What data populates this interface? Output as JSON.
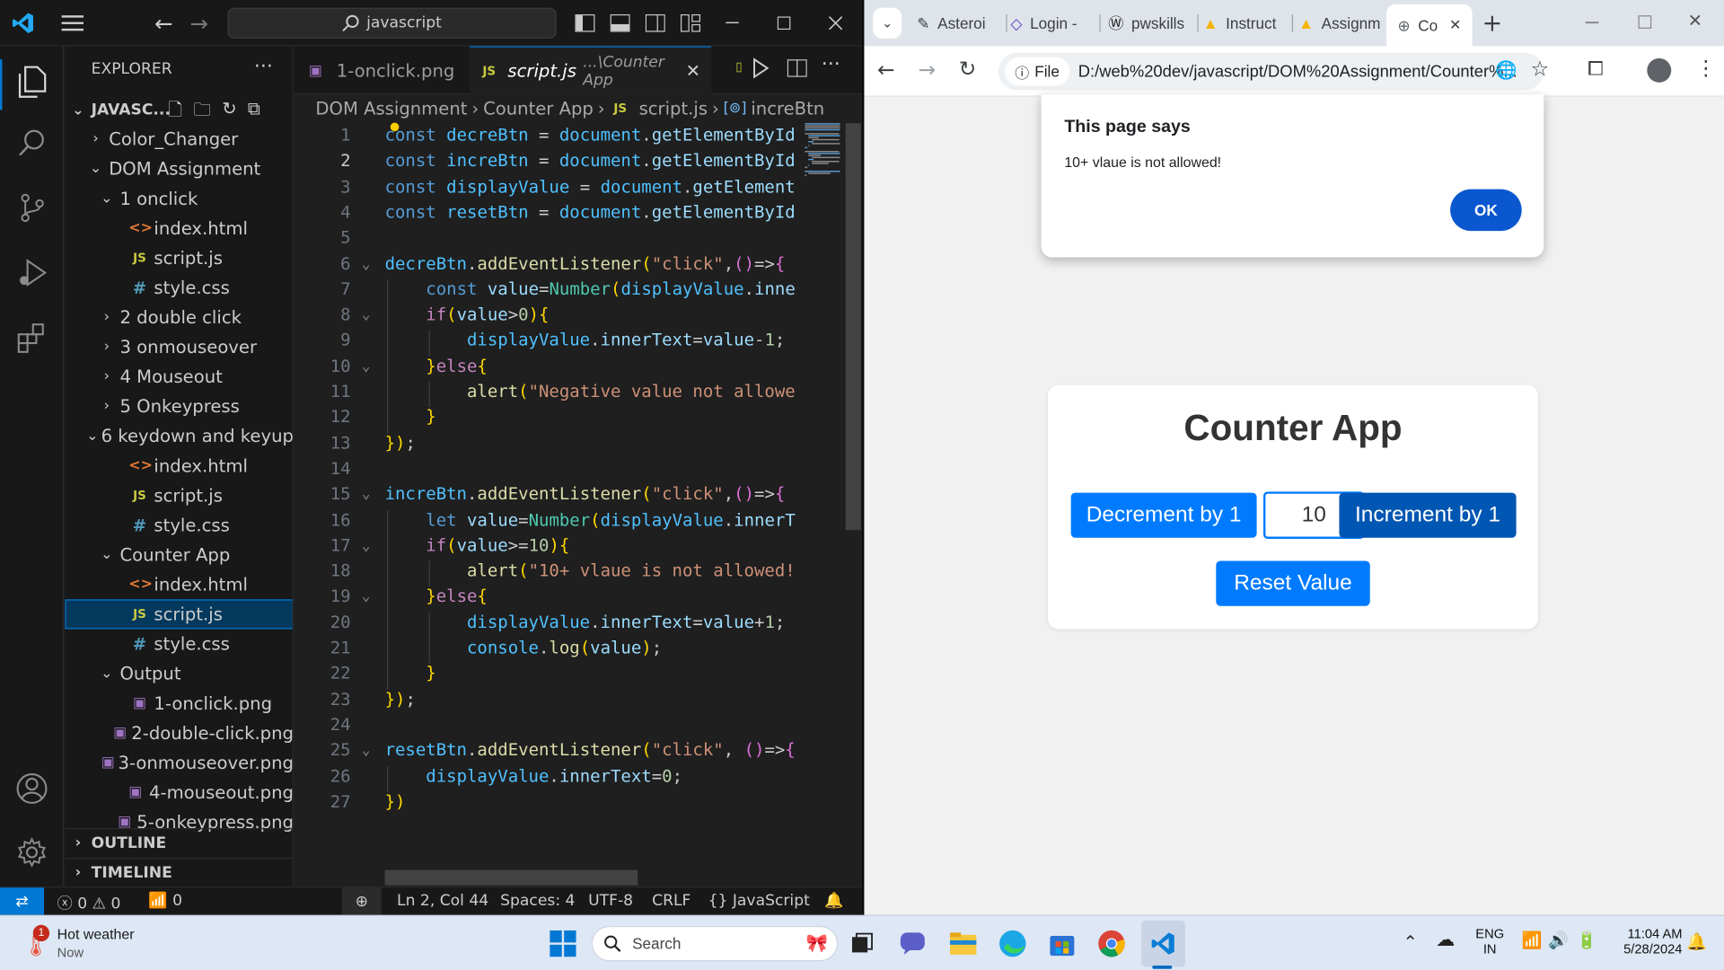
{
  "colors": {
    "vscode_bg": "#1f1f1f",
    "vscode_accent": "#0078d4",
    "chrome_primary_button": "#007bff",
    "dialog_ok": "#0b57d0"
  },
  "vscode": {
    "command_center": "javascript",
    "explorer": {
      "title": "EXPLORER",
      "root": "JAVASC...",
      "items": [
        {
          "label": "Color_Changer",
          "type": "folder",
          "open": false,
          "depth": 0
        },
        {
          "label": "DOM Assignment",
          "type": "folder",
          "open": true,
          "depth": 0
        },
        {
          "label": "1 onclick",
          "type": "folder",
          "open": true,
          "depth": 1
        },
        {
          "label": "index.html",
          "type": "html",
          "depth": 2
        },
        {
          "label": "script.js",
          "type": "js",
          "depth": 2
        },
        {
          "label": "style.css",
          "type": "css",
          "depth": 2
        },
        {
          "label": "2 double click",
          "type": "folder",
          "open": false,
          "depth": 1
        },
        {
          "label": "3 onmouseover",
          "type": "folder",
          "open": false,
          "depth": 1
        },
        {
          "label": "4 Mouseout",
          "type": "folder",
          "open": false,
          "depth": 1
        },
        {
          "label": "5 Onkeypress",
          "type": "folder",
          "open": false,
          "depth": 1
        },
        {
          "label": "6 keydown and keyup",
          "type": "folder",
          "open": true,
          "depth": 1
        },
        {
          "label": "index.html",
          "type": "html",
          "depth": 2
        },
        {
          "label": "script.js",
          "type": "js",
          "depth": 2
        },
        {
          "label": "style.css",
          "type": "css",
          "depth": 2
        },
        {
          "label": "Counter App",
          "type": "folder",
          "open": true,
          "depth": 1
        },
        {
          "label": "index.html",
          "type": "html",
          "depth": 2
        },
        {
          "label": "script.js",
          "type": "js",
          "depth": 2,
          "selected": true
        },
        {
          "label": "style.css",
          "type": "css",
          "depth": 2
        },
        {
          "label": "Output",
          "type": "folder",
          "open": true,
          "depth": 1
        },
        {
          "label": "1-onclick.png",
          "type": "png",
          "depth": 2
        },
        {
          "label": "2-double-click.png",
          "type": "png",
          "depth": 2
        },
        {
          "label": "3-onmouseover.png",
          "type": "png",
          "depth": 2
        },
        {
          "label": "4-mouseout.png",
          "type": "png",
          "depth": 2
        },
        {
          "label": "5-onkeypress.png",
          "type": "png",
          "depth": 2
        }
      ],
      "outline": "OUTLINE",
      "timeline": "TIMELINE"
    },
    "tabs": [
      {
        "label": "1-onclick.png",
        "active": false
      },
      {
        "label": "script.js",
        "path": "...\\Counter App",
        "active": true
      }
    ],
    "breadcrumbs": [
      "DOM Assignment",
      "Counter App",
      "script.js",
      "increBtn"
    ],
    "code": {
      "current_line": 2,
      "fold_lines": [
        6,
        8,
        10,
        15,
        17,
        19,
        25
      ],
      "lines": [
        "const decreBtn = document.getElementById",
        "const increBtn = document.getElementById",
        "const displayValue = document.getElement",
        "const resetBtn = document.getElementById",
        "",
        "decreBtn.addEventListener(\"click\",()=>{",
        "    const value=Number(displayValue.inne",
        "    if(value>0){",
        "        displayValue.innerText=value-1;",
        "    }else{",
        "        alert(\"Negative value not allowe",
        "    }",
        "});",
        "",
        "increBtn.addEventListener(\"click\",()=>{",
        "    let value=Number(displayValue.innerT",
        "    if(value>=10){",
        "        alert(\"10+ vlaue is not allowed!",
        "    }else{",
        "        displayValue.innerText=value+1;",
        "        console.log(value);",
        "    }",
        "});",
        "",
        "resetBtn.addEventListener(\"click\", ()=>{",
        "    displayValue.innerText=0;",
        "})"
      ]
    },
    "status": {
      "errors": "0",
      "warnings": "0",
      "ports": "0",
      "position": "Ln 2, Col 44",
      "spaces": "Spaces: 4",
      "encoding": "UTF-8",
      "eol": "CRLF",
      "language": "JavaScript"
    }
  },
  "chrome": {
    "tabs": [
      {
        "label": "Asteroi",
        "icon": "asteroid-icon"
      },
      {
        "label": "Login -",
        "icon": "code-icon"
      },
      {
        "label": "pwskills",
        "icon": "wordpress-icon"
      },
      {
        "label": "Instruct",
        "icon": "drive-icon"
      },
      {
        "label": "Assignm",
        "icon": "drive-icon"
      },
      {
        "label": "Co",
        "icon": "globe-icon",
        "active": true
      }
    ],
    "site_info": "File",
    "url": "D:/web%20dev/javascript/DOM%20Assignment/Counter%...",
    "dialog": {
      "title": "This page says",
      "message": "10+ vlaue is not allowed!",
      "ok": "OK"
    },
    "app": {
      "title": "Counter App",
      "decrement": "Decrement by 1",
      "value": "10",
      "increment": "Increment by 1",
      "reset": "Reset Value"
    }
  },
  "taskbar": {
    "weather_title": "Hot weather",
    "weather_sub": "Now",
    "weather_badge": "1",
    "search": "Search",
    "lang_top": "ENG",
    "lang_bottom": "IN",
    "time": "11:04 AM",
    "date": "5/28/2024"
  }
}
